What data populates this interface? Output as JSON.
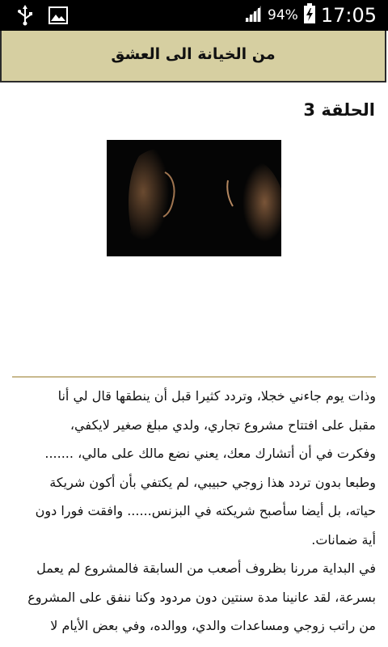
{
  "status_bar": {
    "battery_percent": "94%",
    "time": "17:05",
    "icons": [
      "usb-icon",
      "image-notification-icon",
      "signal-icon",
      "battery-charging-icon"
    ]
  },
  "app_bar": {
    "title": "من الخيانة الى العشق"
  },
  "episode": {
    "title": "الحلقة 3"
  },
  "story_lines": [
    "وذات يوم جاءني خجلا، وتردد كثيرا قبل أن ينطقها قال لي أنا",
    "مقبل على افتتاح مشروع تجاري، ولدي مبلغ صغير لايكفي،",
    "وفكرت في أن أتشارك معك، يعني نضع مالك على مالي، .......",
    "وطبعا بدون تردد هذا زوجي حبيبي، لم يكتفي بأن أكون شريكة",
    "حياته، بل أيضا سأصبح شريكته في البزنس...... وافقت فورا دون",
    "أية ضمانات.",
    "في البداية مررنا بظروف أصعب من السابقة فالمشروع لم يعمل",
    "بسرعة، لقد عانينا مدة سنتين دون مردود وكنا ننفق على المشروع",
    "من راتب زوجي ومساعدات والدي، ووالده، وفي بعض الأيام لا"
  ]
}
